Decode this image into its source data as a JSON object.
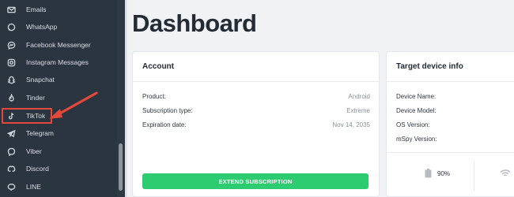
{
  "sidebar": {
    "items": [
      {
        "label": "Emails",
        "icon": "envelope-icon"
      },
      {
        "label": "WhatsApp",
        "icon": "whatsapp-icon"
      },
      {
        "label": "Facebook Messenger",
        "icon": "messenger-icon"
      },
      {
        "label": "Instagram Messages",
        "icon": "instagram-icon"
      },
      {
        "label": "Snapchat",
        "icon": "snapchat-icon"
      },
      {
        "label": "Tinder",
        "icon": "tinder-icon"
      },
      {
        "label": "TikTok",
        "icon": "tiktok-icon"
      },
      {
        "label": "Telegram",
        "icon": "telegram-icon"
      },
      {
        "label": "Viber",
        "icon": "viber-icon"
      },
      {
        "label": "Discord",
        "icon": "discord-icon"
      },
      {
        "label": "LINE",
        "icon": "line-icon"
      }
    ],
    "highlighted": "TikTok"
  },
  "page": {
    "title": "Dashboard"
  },
  "account": {
    "title": "Account",
    "rows": [
      {
        "key": "Product:",
        "value": "Android"
      },
      {
        "key": "Subscription type:",
        "value": "Extreme"
      },
      {
        "key": "Expiration date:",
        "value": "Nov 14, 2035"
      }
    ],
    "cta_label": "EXTEND SUBSCRIPTION"
  },
  "target": {
    "title": "Target device info",
    "rows": [
      "Device Name:",
      "Device Model:",
      "OS Version:",
      "mSpy Version:"
    ],
    "battery": "90%"
  },
  "colors": {
    "sidebar_bg": "#2b3540",
    "accent_green": "#2ecc71",
    "highlight_red": "#e2483b"
  }
}
